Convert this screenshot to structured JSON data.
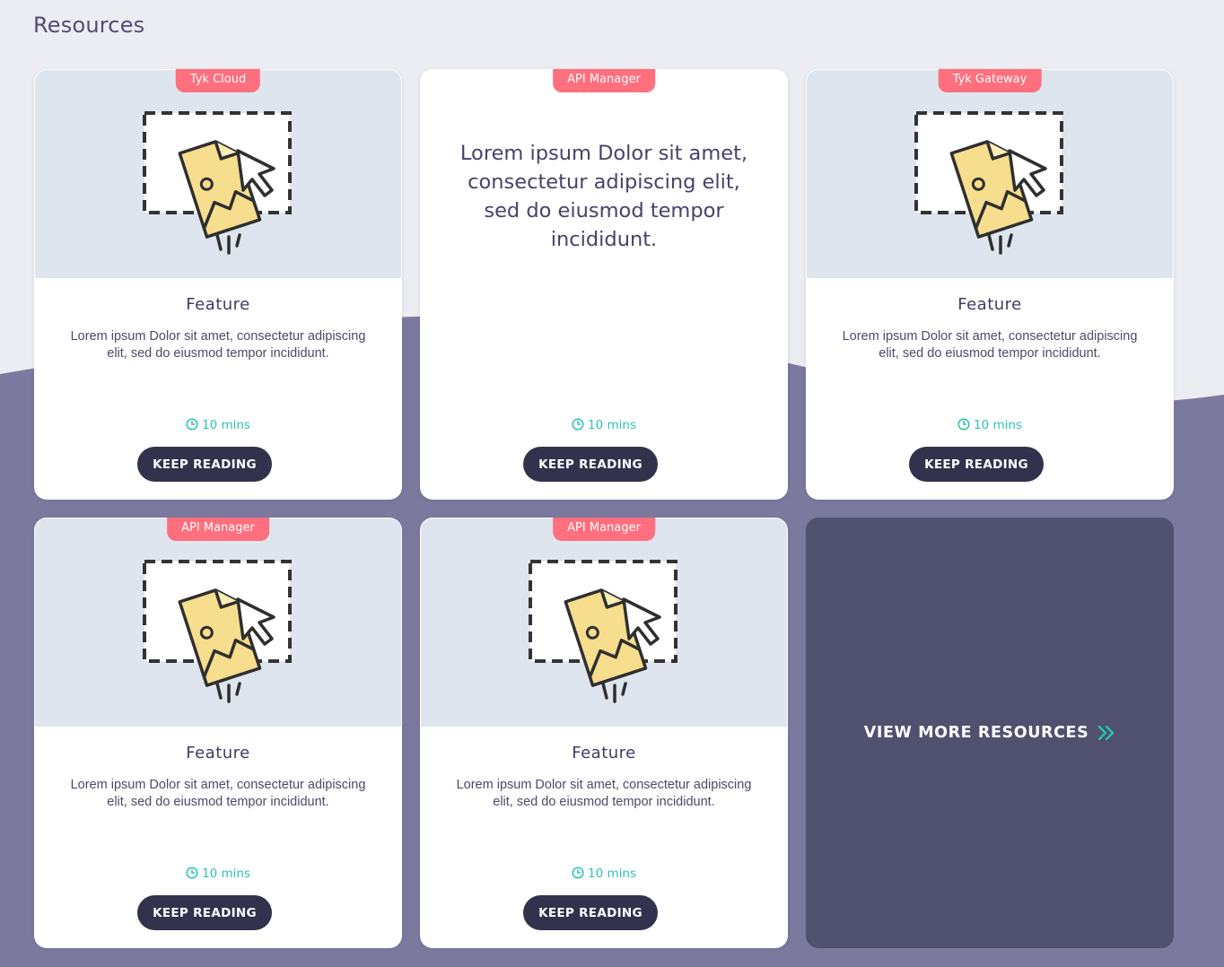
{
  "page": {
    "title": "Resources"
  },
  "colors": {
    "accent": "#28c4b0",
    "tag": "#ff6f7d",
    "button": "#33324c",
    "wave": "#7b7a9e",
    "more_card": "#50506f"
  },
  "cards": [
    {
      "tag": "Tyk Cloud",
      "title": "Feature",
      "description": "Lorem ipsum Dolor sit amet, consectetur adipiscing elit, sed do eiusmod tempor incididunt.",
      "read_time": "10 mins",
      "button": "KEEP READING",
      "icon": "file-upload-illustration"
    },
    {
      "tag": "API Manager",
      "quote": "Lorem ipsum Dolor sit amet, consectetur adipiscing elit, sed do eiusmod tempor incididunt.",
      "read_time": "10 mins",
      "button": "KEEP READING"
    },
    {
      "tag": "Tyk Gateway",
      "title": "Feature",
      "description": "Lorem ipsum Dolor sit amet, consectetur adipiscing elit, sed do eiusmod tempor incididunt.",
      "read_time": "10 mins",
      "button": "KEEP READING",
      "icon": "file-upload-illustration"
    },
    {
      "tag": "API Manager",
      "title": "Feature",
      "description": "Lorem ipsum Dolor sit amet, consectetur adipiscing elit, sed do eiusmod tempor incididunt.",
      "read_time": "10 mins",
      "button": "KEEP READING",
      "icon": "file-upload-illustration"
    },
    {
      "tag": "API Manager",
      "title": "Feature",
      "description": "Lorem ipsum Dolor sit amet, consectetur adipiscing elit, sed do eiusmod tempor incididunt.",
      "read_time": "10 mins",
      "button": "KEEP READING",
      "icon": "file-upload-illustration"
    }
  ],
  "view_more": {
    "label": "VIEW MORE RESOURCES",
    "icon": "double-chevron-right-icon"
  }
}
